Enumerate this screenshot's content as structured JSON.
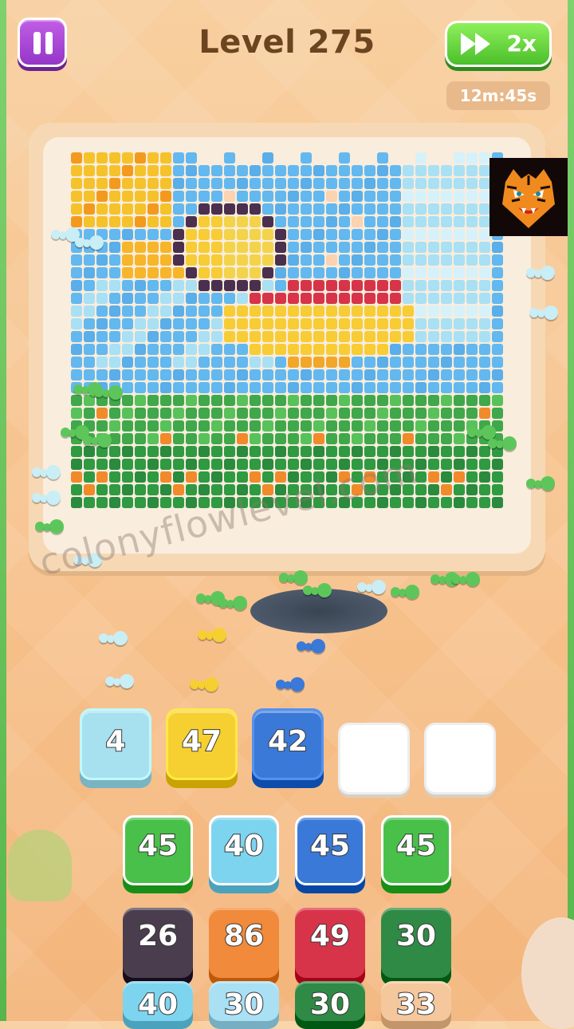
{
  "header": {
    "level_title": "Level 275",
    "speed_label": "2x",
    "timer": "12m:45s"
  },
  "board": {
    "description_colors": {
      "sky": "#63b8ef",
      "sky_light": "#a9e0f4",
      "sun": "#f6c22c",
      "duck_yellow": "#f7cc35",
      "duck_red": "#d7344a",
      "outline": "#4b2f4f",
      "grass": "#3fa84a",
      "grass_dark": "#2a8a3d",
      "flower": "#f08a2a"
    }
  },
  "watermark": "colonyflowlevel.com",
  "queue": [
    {
      "value": "4",
      "color": "#a7e0ef"
    },
    {
      "value": "47",
      "color": "#f6cf30"
    },
    {
      "value": "42",
      "color": "#3a79d8"
    },
    {
      "value": "",
      "color": "#ffffff"
    },
    {
      "value": "",
      "color": "#ffffff"
    }
  ],
  "tiles": {
    "row1": [
      {
        "value": "45",
        "color": "#49c04a"
      },
      {
        "value": "40",
        "color": "#7dd4ef"
      },
      {
        "value": "45",
        "color": "#3a79d8"
      },
      {
        "value": "45",
        "color": "#49c04a"
      }
    ],
    "row2": [
      {
        "value": "26",
        "color": "#4a3e4e"
      },
      {
        "value": "86",
        "color": "#f18a3a"
      },
      {
        "value": "49",
        "color": "#d7344a"
      },
      {
        "value": "30",
        "color": "#2f8a45"
      }
    ],
    "row3": [
      {
        "value": "40",
        "color": "#7dd4ef"
      },
      {
        "value": "30",
        "color": "#a9e0f4"
      },
      {
        "value": "30",
        "color": "#2f8a45"
      },
      {
        "value": "33",
        "color": "#f5c79d"
      }
    ]
  }
}
